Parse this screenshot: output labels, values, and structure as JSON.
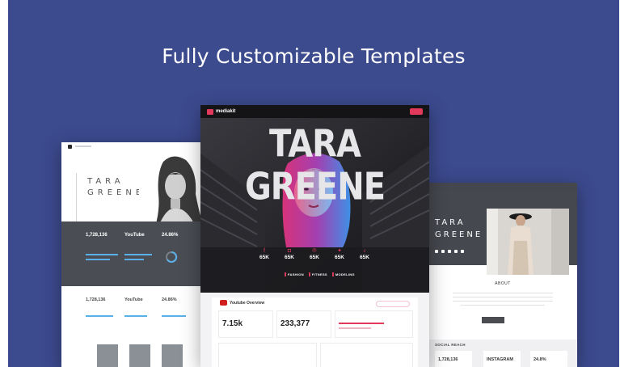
{
  "headline": "Fully Customizable Templates",
  "colors": {
    "background": "#3c4a8e",
    "accent": "#e0395b",
    "dark": "#4a4d54",
    "bar": "#5ab0e8"
  },
  "left_card": {
    "name_line1": "TARA",
    "name_line2": "GREENE",
    "stats": [
      {
        "value": "1,728,136"
      },
      {
        "value": "YouTube"
      },
      {
        "value": "24.86%"
      }
    ],
    "lower_stats": [
      {
        "value": "1,728,136"
      },
      {
        "value": "YouTube"
      },
      {
        "value": "24.86%"
      }
    ]
  },
  "center_card": {
    "logo": "mediakit",
    "hero_name": "TARA GREENE",
    "socials": [
      {
        "icon": "facebook-icon",
        "glyph": "f",
        "count": "65K"
      },
      {
        "icon": "instagram-icon",
        "glyph": "◘",
        "count": "65K"
      },
      {
        "icon": "pinterest-icon",
        "glyph": "℗",
        "count": "65K"
      },
      {
        "icon": "twitter-icon",
        "glyph": "✦",
        "count": "65K"
      },
      {
        "icon": "tiktok-icon",
        "glyph": "♪",
        "count": "65K"
      }
    ],
    "tags": [
      "FASHION",
      "FITNESS",
      "MODELING"
    ],
    "panel": {
      "title": "Youtube Overview",
      "subscribers": "7.15k",
      "views": "233,377"
    }
  },
  "right_card": {
    "name_line1": "TARA",
    "name_line2": "GREENE",
    "about": "ABOUT",
    "section_title": "SOCIAL REACH",
    "tiles": [
      {
        "value": "1,728,136"
      },
      {
        "value": "INSTAGRAM"
      },
      {
        "value": "24.8%"
      }
    ]
  }
}
